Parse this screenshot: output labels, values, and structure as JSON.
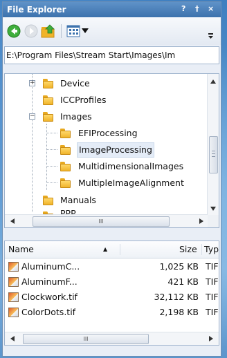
{
  "window": {
    "title": "File Explorer",
    "controls": [
      "?",
      "†",
      "×"
    ]
  },
  "toolbar": {
    "back_icon": "back-arrow-icon",
    "forward_icon": "forward-arrow-icon",
    "up_icon": "up-folder-icon",
    "view_icon": "view-grid-icon",
    "dropdown_icon": "chevron-down-icon",
    "overflow_icon": "overflow-icon"
  },
  "address": {
    "path": "E:\\Program Files\\Stream Start\\Images\\Im"
  },
  "tree": {
    "items": [
      {
        "label": "Device",
        "expander": "+"
      },
      {
        "label": "ICCProfiles",
        "expander": ""
      },
      {
        "label": "Images",
        "expander": "−"
      },
      {
        "label": "EFIProcessing",
        "expander": ""
      },
      {
        "label": "ImageProcessing",
        "expander": ""
      },
      {
        "label": "MultidimensionalImages",
        "expander": ""
      },
      {
        "label": "MultipleImageAlignment",
        "expander": ""
      },
      {
        "label": "Manuals",
        "expander": ""
      },
      {
        "label": "PPP",
        "expander": ""
      }
    ],
    "scrollbar_thumb": "III"
  },
  "list": {
    "columns": {
      "name": "Name",
      "size": "Size",
      "type": "Typ"
    },
    "sort_indicator": "▲",
    "rows": [
      {
        "name": "AluminumC...",
        "size": "1,025 KB",
        "type": "TIF"
      },
      {
        "name": "AluminumF...",
        "size": "421 KB",
        "type": "TIF"
      },
      {
        "name": "Clockwork.tif",
        "size": "32,112 KB",
        "type": "TIF"
      },
      {
        "name": "ColorDots.tif",
        "size": "2,198 KB",
        "type": "TIF"
      }
    ],
    "scrollbar_thumb": "III"
  },
  "colors": {
    "titlebar": "#3c72ad",
    "selection": "#e4ecf7",
    "folder": "#f0b42a"
  }
}
